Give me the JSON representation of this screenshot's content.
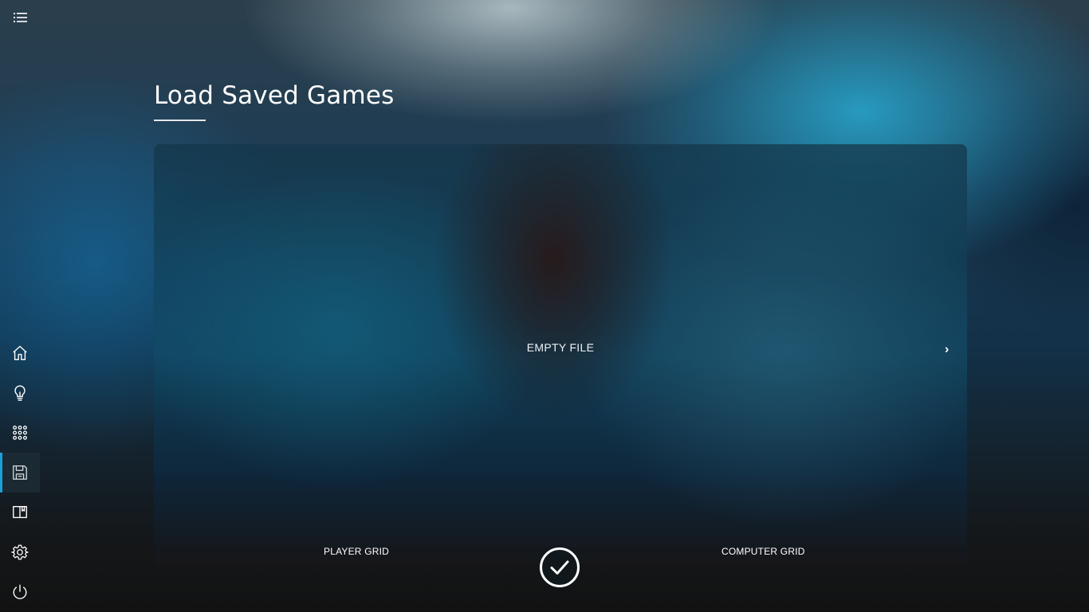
{
  "header": {
    "menu_icon": "list-menu-icon"
  },
  "page": {
    "title": "Load Saved Games"
  },
  "sidebar": {
    "items": [
      {
        "icon": "home-icon",
        "active": false
      },
      {
        "icon": "lightbulb-icon",
        "active": false
      },
      {
        "icon": "grid-dots-icon",
        "active": false
      },
      {
        "icon": "save-disk-icon",
        "active": true
      },
      {
        "icon": "book-icon",
        "active": false
      },
      {
        "icon": "gear-icon",
        "active": false
      },
      {
        "icon": "power-icon",
        "active": false
      }
    ]
  },
  "save_slot": {
    "file_label": "EMPTY FILE",
    "next_label": "›",
    "player_grid_label": "PLAYER GRID",
    "computer_grid_label": "COMPUTER GRID"
  },
  "actions": {
    "confirm_icon": "checkmark-icon"
  },
  "colors": {
    "accent": "#1a9fd6",
    "text": "#ffffff"
  }
}
